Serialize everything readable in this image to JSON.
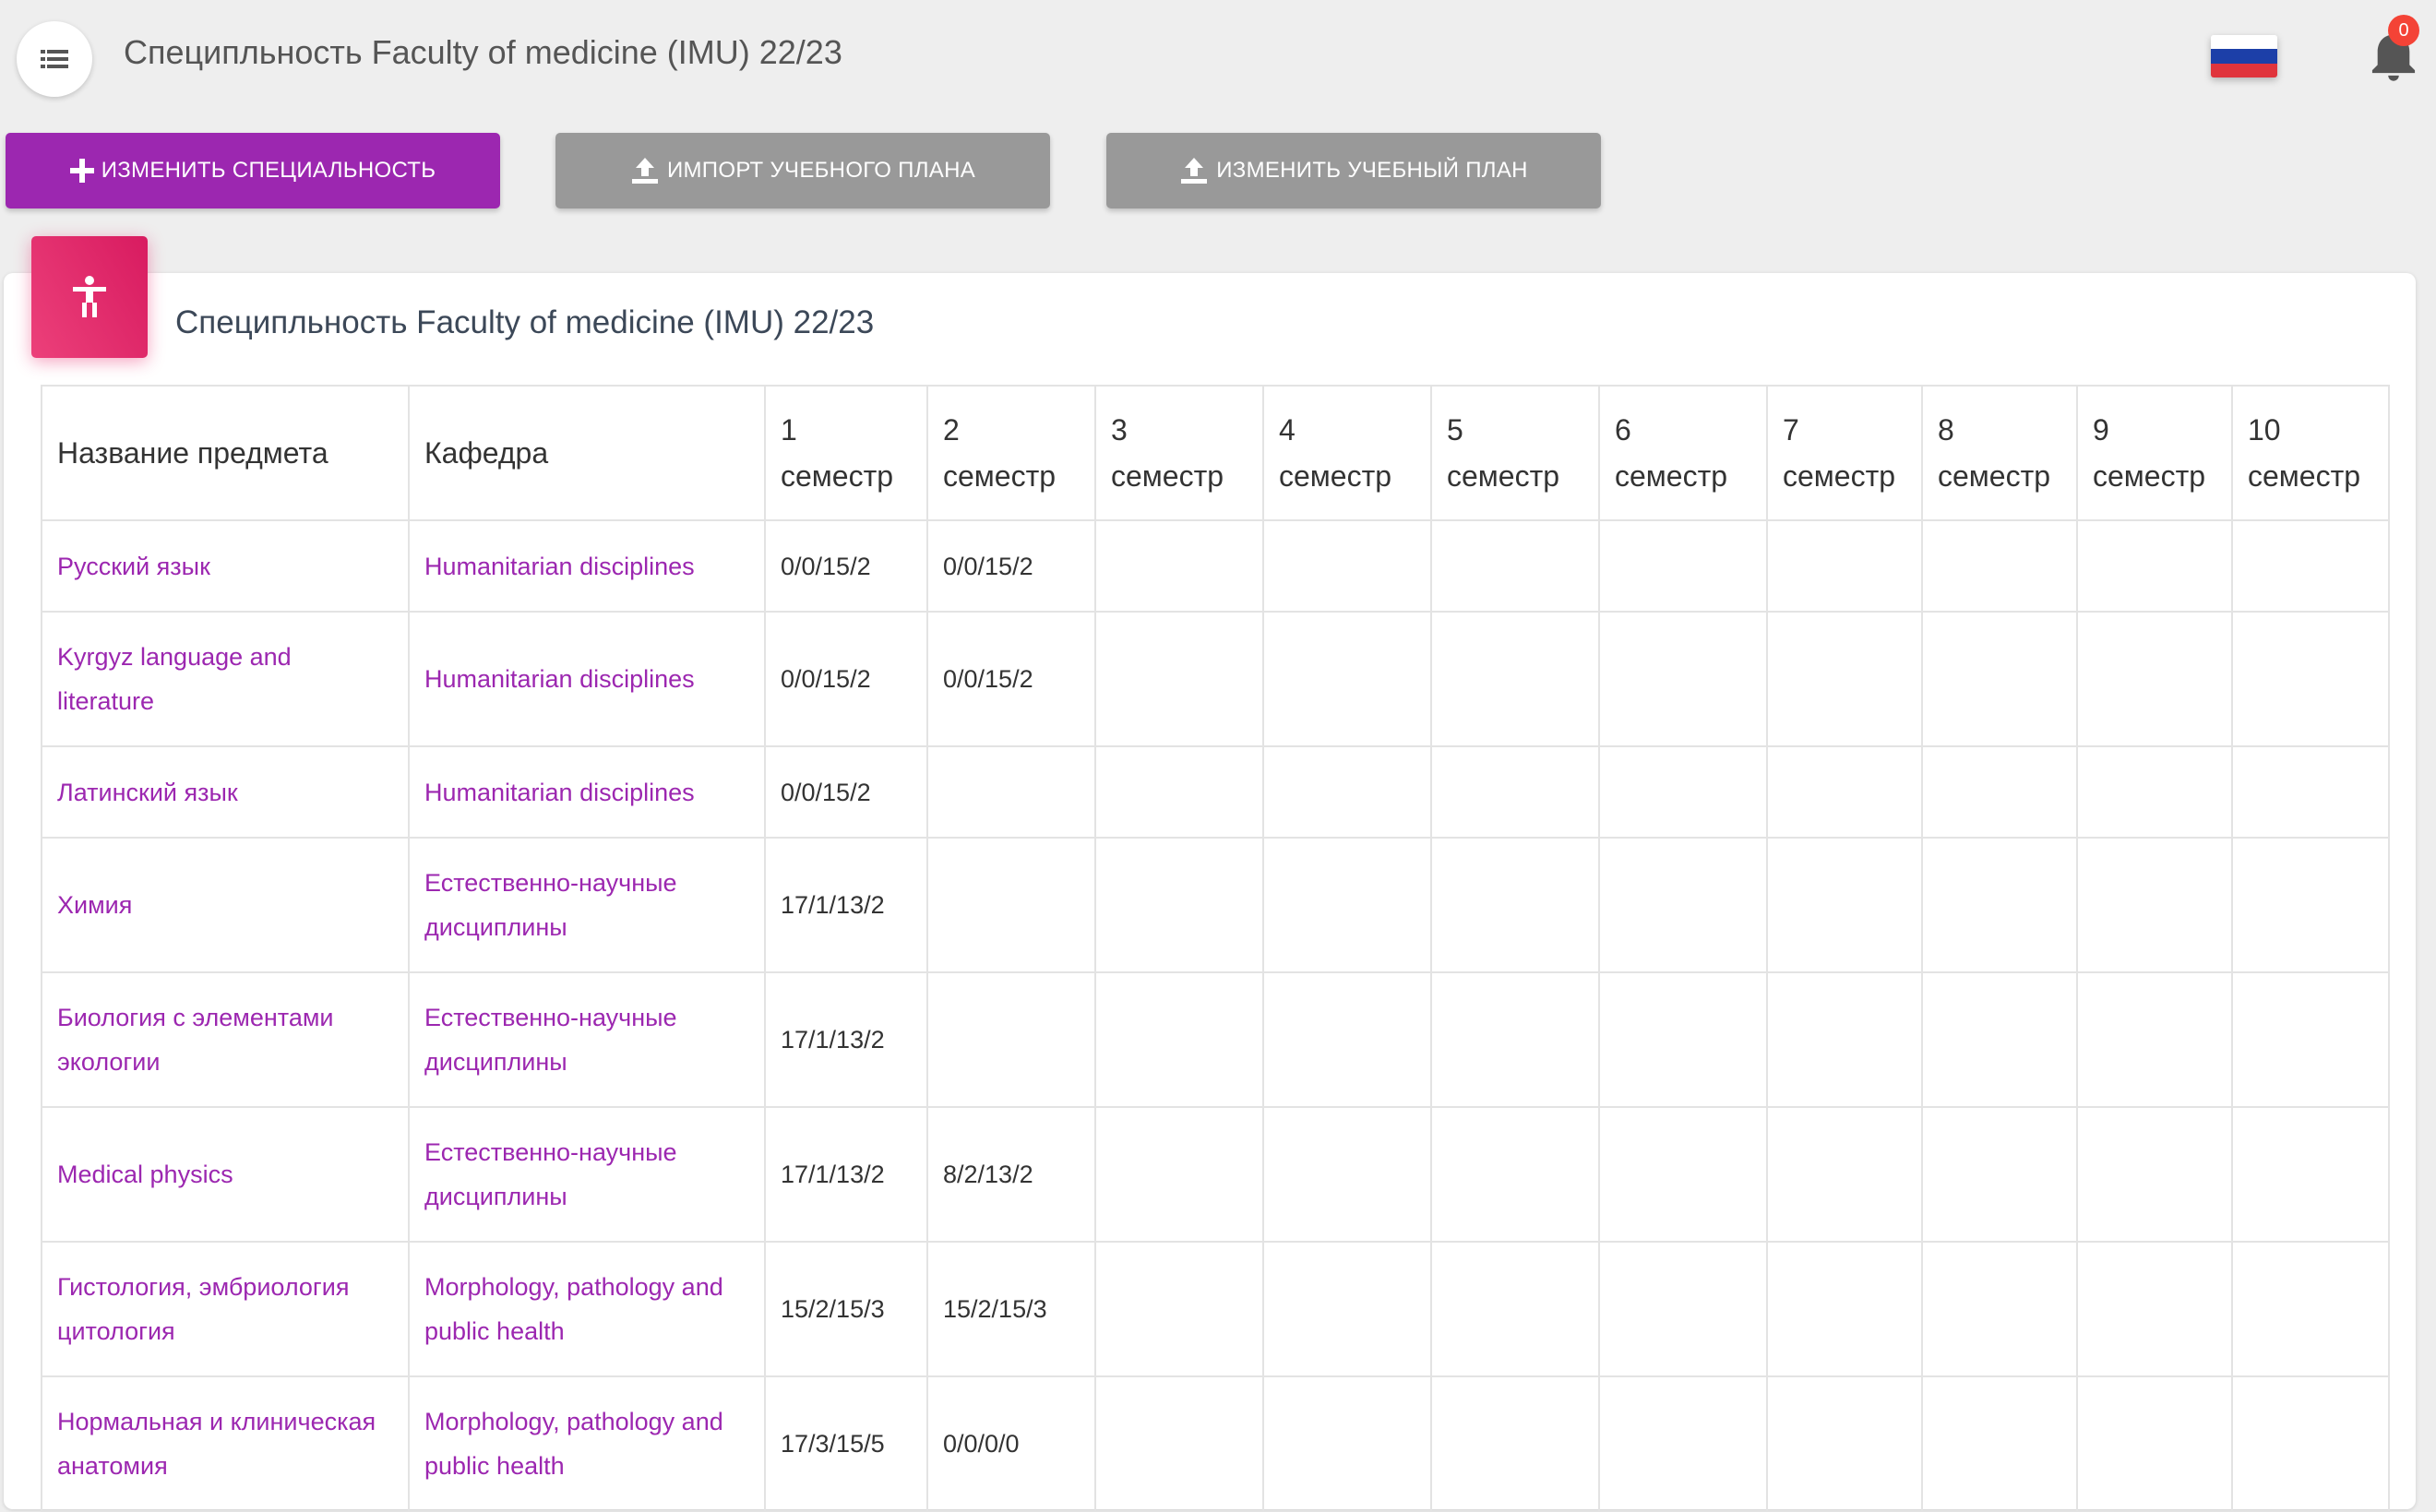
{
  "header": {
    "title": "Специпльность Faculty of medicine (IMU) 22/23",
    "notifications_count": "0"
  },
  "buttons": {
    "change_specialty": "Изменить специальность",
    "import_plan": "Импорт учебного плана",
    "edit_plan": "Изменить учебный план"
  },
  "colors": {
    "primary": "#9c27b0",
    "card_icon": "#e91e63",
    "button_gray": "#999999",
    "badge": "#f44336"
  },
  "card": {
    "title": "Специпльность Faculty of medicine (IMU) 22/23"
  },
  "table": {
    "headers": {
      "subject": "Название предмета",
      "department": "Кафедра",
      "semester_word": "семестр",
      "semesters": [
        "1",
        "2",
        "3",
        "4",
        "5",
        "6",
        "7",
        "8",
        "9",
        "10"
      ]
    },
    "rows": [
      {
        "subject": "Русский язык",
        "department": "Humanitarian disciplines",
        "s1": "0/0/15/2",
        "s2": "0/0/15/2"
      },
      {
        "subject": "Kyrgyz language and literature",
        "department": "Humanitarian disciplines",
        "s1": "0/0/15/2",
        "s2": "0/0/15/2"
      },
      {
        "subject": "Латинский язык",
        "department": "Humanitarian disciplines",
        "s1": "0/0/15/2",
        "s2": ""
      },
      {
        "subject": "Химия",
        "department": "Естественно-научные дисциплины",
        "s1": "17/1/13/2",
        "s2": ""
      },
      {
        "subject": "Биология с элементами экологии",
        "department": "Естественно-научные дисциплины",
        "s1": "17/1/13/2",
        "s2": ""
      },
      {
        "subject": "Medical physics",
        "department": "Естественно-научные дисциплины",
        "s1": "17/1/13/2",
        "s2": "8/2/13/2"
      },
      {
        "subject": "Гистология, эмбриология цитология",
        "department": "Morphology, pathology and public health",
        "s1": "15/2/15/3",
        "s2": "15/2/15/3"
      },
      {
        "subject": "Нормальная и клиническая анатомия",
        "department": "Morphology, pathology and public health",
        "s1": "17/3/15/5",
        "s2": "0/0/0/0"
      }
    ]
  },
  "icons": {
    "menu": "view-list-icon",
    "flag": "russia-flag-icon",
    "bell": "bell-icon",
    "add": "plus-icon",
    "upload": "upload-icon",
    "card": "accessibility-icon"
  }
}
